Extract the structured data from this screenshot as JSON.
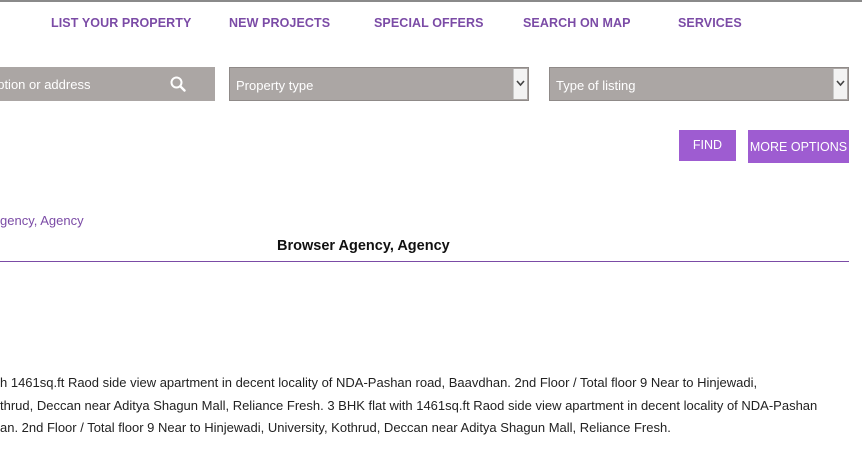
{
  "nav": {
    "items": [
      "LIST YOUR PROPERTY",
      "NEW PROJECTS",
      "SPECIAL OFFERS",
      "SEARCH ON MAP",
      "SERVICES"
    ]
  },
  "search": {
    "placeholder": "ription or address",
    "icon": "search-icon",
    "property_type": "Property type",
    "listing_type": "Type of listing",
    "find_label": "FIND",
    "more_options_label": "MORE OPTIONS"
  },
  "breadcrumb": "gency, Agency",
  "page_title": "Browser Agency, Agency",
  "description": {
    "lines": [
      "h 1461sq.ft Raod side view apartment in decent locality of NDA-Pashan road, Baavdhan. 2nd Floor / Total floor 9 Near to Hinjewadi,",
      "thrud, Deccan near Aditya Shagun Mall, Reliance Fresh. 3 BHK flat with 1461sq.ft Raod side view apartment in decent locality of NDA-Pashan",
      "an. 2nd Floor / Total floor 9 Near to Hinjewadi, University, Kothrud, Deccan near Aditya Shagun Mall, Reliance Fresh."
    ]
  },
  "colors": {
    "accent": "#7b4ba6",
    "button": "#9e5cd1",
    "field_bg": "#aba6a4"
  }
}
